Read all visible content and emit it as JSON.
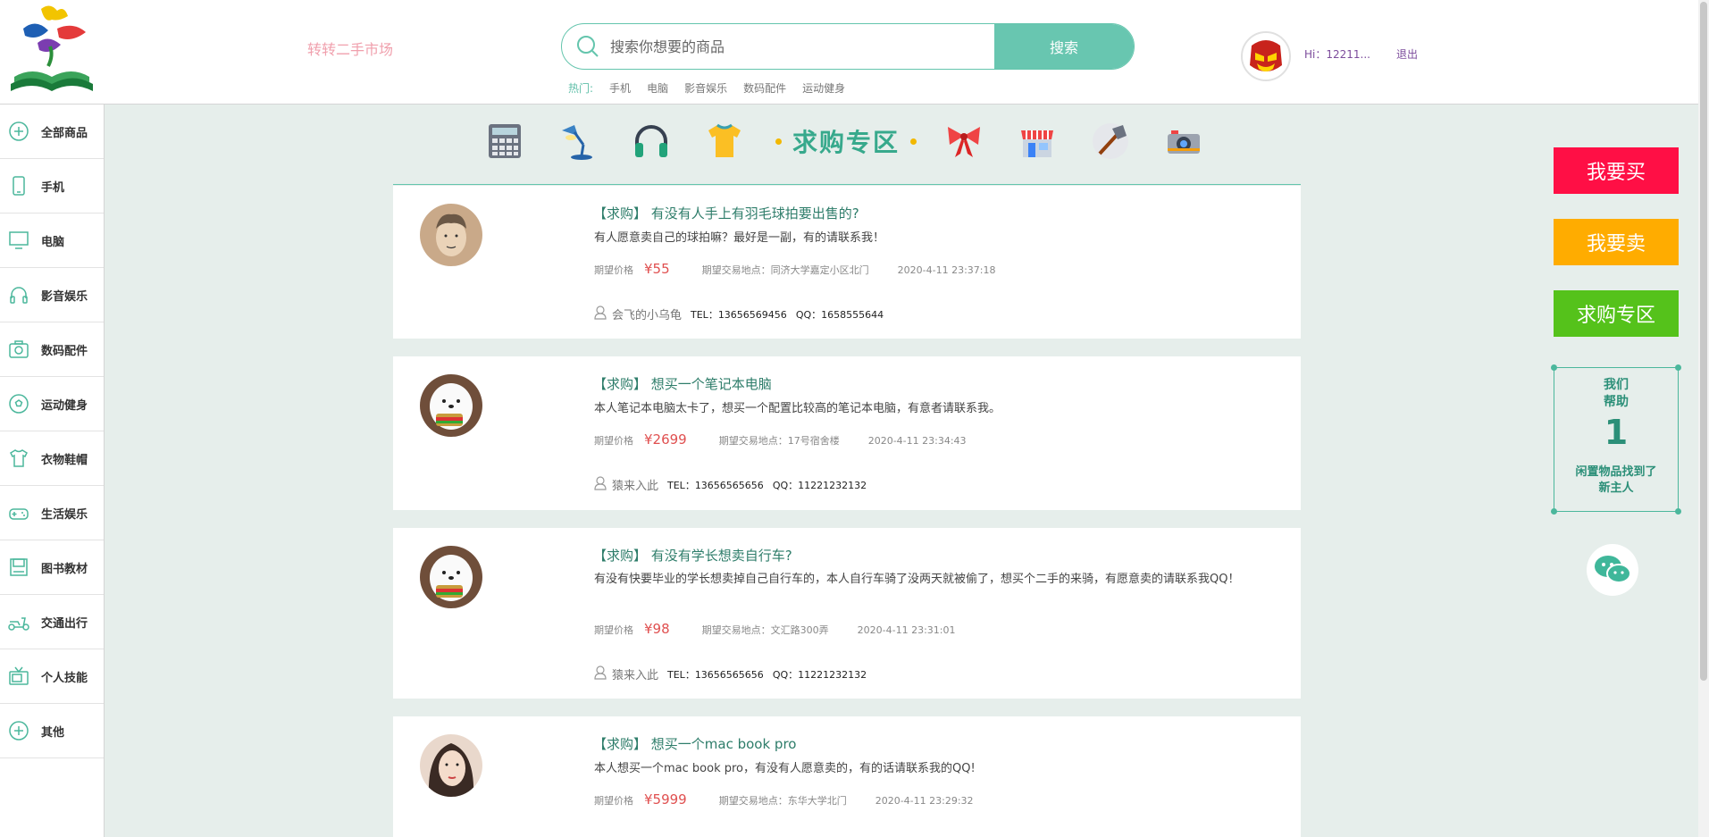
{
  "header": {
    "site_name": "转转二手市场",
    "search_placeholder": "搜索你想要的商品",
    "search_button": "搜索",
    "hot_label": "热门:",
    "hot_keywords": [
      "手机",
      "电脑",
      "影音娱乐",
      "数码配件",
      "运动健身"
    ],
    "user_greeting": "Hi：12211...",
    "logout": "退出"
  },
  "sidebar": {
    "items": [
      {
        "label": "全部商品",
        "icon": "plus-circle-icon"
      },
      {
        "label": "手机",
        "icon": "phone-icon"
      },
      {
        "label": "电脑",
        "icon": "monitor-icon"
      },
      {
        "label": "影音娱乐",
        "icon": "headphones-icon"
      },
      {
        "label": "数码配件",
        "icon": "camera-icon"
      },
      {
        "label": "运动健身",
        "icon": "soccer-ball-icon"
      },
      {
        "label": "衣物鞋帽",
        "icon": "shirt-icon"
      },
      {
        "label": "生活娱乐",
        "icon": "gamepad-icon"
      },
      {
        "label": "图书教材",
        "icon": "book-icon"
      },
      {
        "label": "交通出行",
        "icon": "scooter-icon"
      },
      {
        "label": "个人技能",
        "icon": "tv-icon"
      },
      {
        "label": "其他",
        "icon": "plus-circle-icon"
      }
    ]
  },
  "category_bar": {
    "title": "求购专区",
    "icons": [
      "calculator-icon",
      "desk-lamp-icon",
      "headphones-icon",
      "tshirt-icon",
      "bow-icon",
      "store-icon",
      "axe-icon",
      "camera-icon"
    ]
  },
  "posts": [
    {
      "title": "【求购】 有没有人手上有羽毛球拍要出售的?",
      "desc": "有人愿意卖自己的球拍嘛？最好是一副，有的请联系我！",
      "price_label": "期望价格",
      "price": "¥55",
      "location": "期望交易地点：同济大学嘉定小区北门",
      "time": "2020-4-11 23:37:18",
      "user": "会飞的小乌龟",
      "tel": "TEL：13656569456",
      "qq": "QQ：1658555644"
    },
    {
      "title": "【求购】 想买一个笔记本电脑",
      "desc": "本人笔记本电脑太卡了，想买一个配置比较高的笔记本电脑，有意者请联系我。",
      "price_label": "期望价格",
      "price": "¥2699",
      "location": "期望交易地点：17号宿舍楼",
      "time": "2020-4-11 23:34:43",
      "user": "猿来入此",
      "tel": "TEL：13656565656",
      "qq": "QQ：11221232132"
    },
    {
      "title": "【求购】 有没有学长想卖自行车?",
      "desc": "有没有快要毕业的学长想卖掉自己自行车的，本人自行车骑了没两天就被偷了，想买个二手的来骑，有愿意卖的请联系我QQ！",
      "price_label": "期望价格",
      "price": "¥98",
      "location": "期望交易地点：文汇路300弄",
      "time": "2020-4-11 23:31:01",
      "user": "猿来入此",
      "tel": "TEL：13656565656",
      "qq": "QQ：11221232132"
    },
    {
      "title": "【求购】 想买一个mac book pro",
      "desc": "本人想买一个mac book pro，有没有人愿意卖的，有的话请联系我的QQ!",
      "price_label": "期望价格",
      "price": "¥5999",
      "location": "期望交易地点：东华大学北门",
      "time": "2020-4-11 23:29:32",
      "user": "",
      "tel": "",
      "qq": ""
    }
  ],
  "right_panel": {
    "buy": "我要买",
    "sell": "我要卖",
    "wanted": "求购专区",
    "help_line1": "我们",
    "help_line2": "帮助",
    "help_count": "1",
    "help_line3": "闲置物品找到了",
    "help_line4": "新主人"
  },
  "colors": {
    "accent": "#68c6b0",
    "buy": "#ff0f45",
    "sell": "#ffac00",
    "wanted": "#55c21b",
    "price": "#e05050"
  }
}
